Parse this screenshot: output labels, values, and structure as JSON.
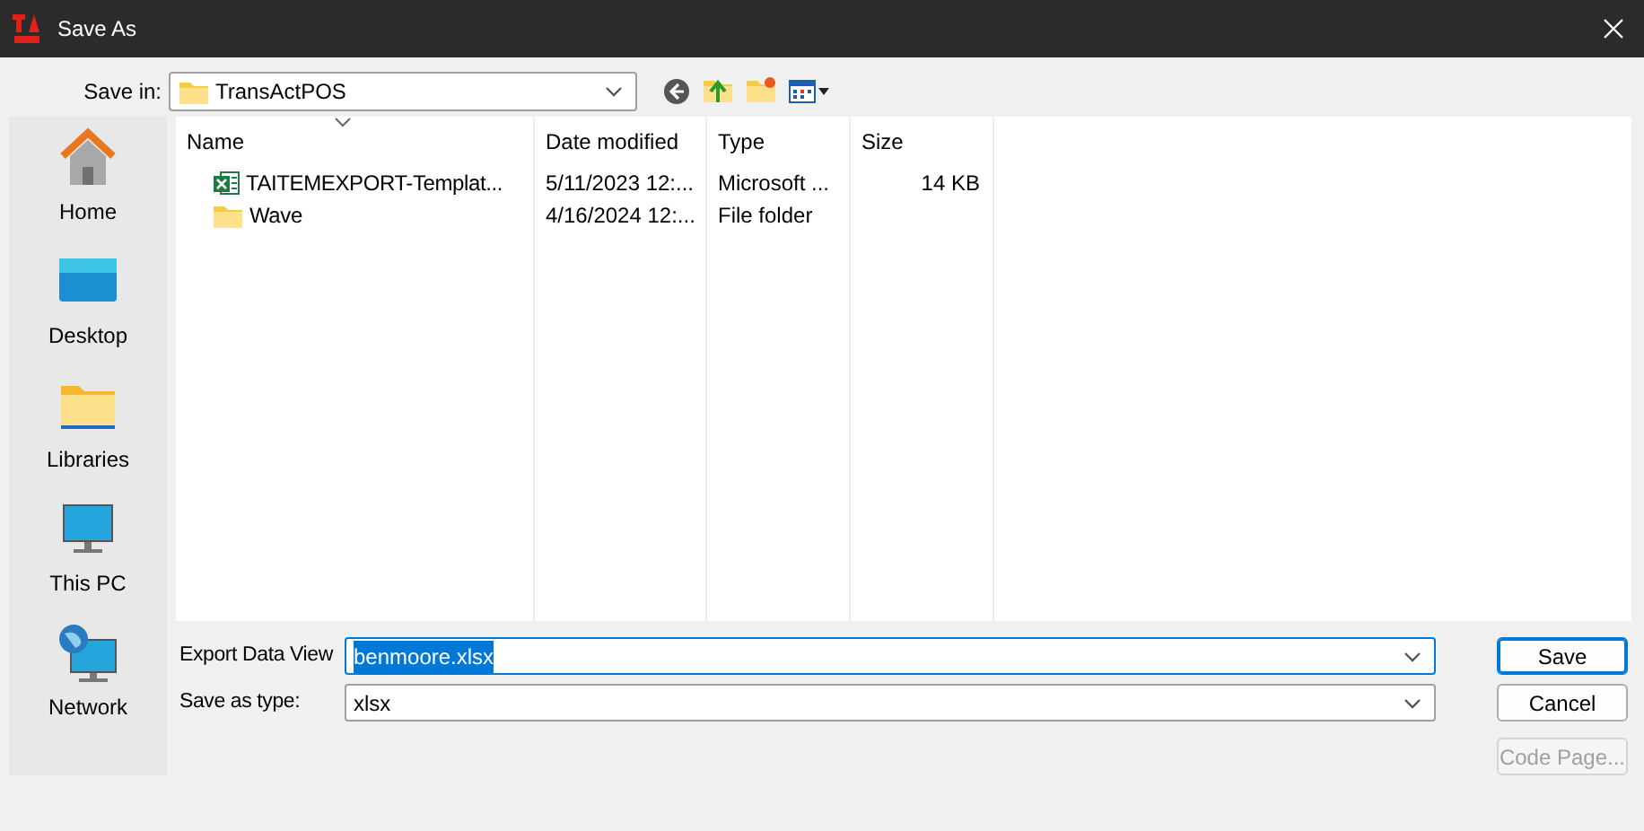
{
  "window": {
    "title": "Save As"
  },
  "save_in": {
    "label": "Save in:",
    "value": "TransActPOS"
  },
  "sidebar": {
    "items": [
      {
        "label": "Home",
        "kind": "home"
      },
      {
        "label": "Desktop",
        "kind": "desktop"
      },
      {
        "label": "Libraries",
        "kind": "libraries"
      },
      {
        "label": "This PC",
        "kind": "pc"
      },
      {
        "label": "Network",
        "kind": "network"
      }
    ]
  },
  "table": {
    "columns": [
      "Name",
      "Date modified",
      "Type",
      "Size"
    ],
    "rows": [
      {
        "kind": "excel",
        "cells": [
          "TAITEMEXPORT-Templat...",
          "5/11/2023 12:...",
          "Microsoft ...",
          "14 KB"
        ]
      },
      {
        "kind": "folder",
        "cells": [
          "Wave",
          "4/16/2024 12:...",
          "File folder",
          ""
        ]
      }
    ]
  },
  "file_name": {
    "label": "Export Data View",
    "value": "benmoore.xlsx",
    "text_selected": true
  },
  "save_as_type": {
    "label": "Save as type:",
    "value": "xlsx"
  },
  "buttons": [
    {
      "label": "Save",
      "default": true,
      "disabled": false
    },
    {
      "label": "Cancel",
      "default": false,
      "disabled": false
    },
    {
      "label": "Code Page...",
      "default": false,
      "disabled": true
    }
  ]
}
